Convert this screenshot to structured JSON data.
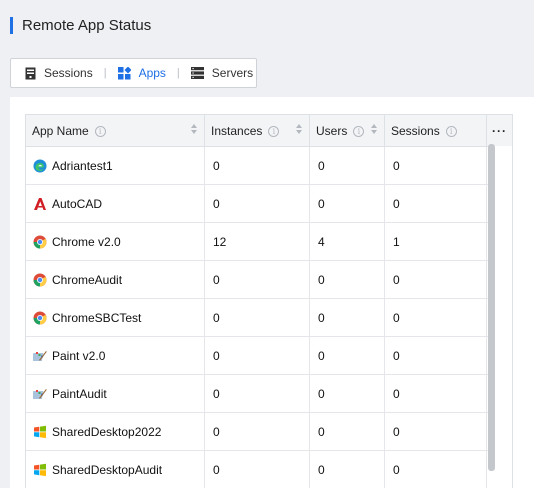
{
  "page": {
    "title": "Remote App Status"
  },
  "tabs": [
    {
      "label": "Sessions",
      "icon": "server-tower-icon",
      "active": false
    },
    {
      "label": "Apps",
      "icon": "apps-grid-icon",
      "active": true
    },
    {
      "label": "Servers",
      "icon": "server-rack-icon",
      "active": false
    }
  ],
  "table": {
    "columns": [
      {
        "label": "App Name"
      },
      {
        "label": "Instances"
      },
      {
        "label": "Users"
      },
      {
        "label": "Sessions"
      },
      {
        "label": "···"
      }
    ],
    "rows": [
      {
        "name": "Adriantest1",
        "icon": "edge-icon",
        "instances": "0",
        "users": "0",
        "sessions": "0"
      },
      {
        "name": "AutoCAD",
        "icon": "autocad-icon",
        "instances": "0",
        "users": "0",
        "sessions": "0"
      },
      {
        "name": "Chrome v2.0",
        "icon": "chrome-icon",
        "instances": "12",
        "users": "4",
        "sessions": "1"
      },
      {
        "name": "ChromeAudit",
        "icon": "chrome-icon",
        "instances": "0",
        "users": "0",
        "sessions": "0"
      },
      {
        "name": "ChromeSBCTest",
        "icon": "chrome-icon",
        "instances": "0",
        "users": "0",
        "sessions": "0"
      },
      {
        "name": "Paint v2.0",
        "icon": "paint-icon",
        "instances": "0",
        "users": "0",
        "sessions": "0"
      },
      {
        "name": "PaintAudit",
        "icon": "paint-icon",
        "instances": "0",
        "users": "0",
        "sessions": "0"
      },
      {
        "name": "SharedDesktop2022",
        "icon": "windows-icon",
        "instances": "0",
        "users": "0",
        "sessions": "0"
      },
      {
        "name": "SharedDesktopAudit",
        "icon": "windows-icon",
        "instances": "0",
        "users": "0",
        "sessions": "0"
      }
    ]
  },
  "colors": {
    "accent": "#1f6fe5",
    "header_bg": "#f3f4f6",
    "page_bg": "#eef0f3"
  }
}
